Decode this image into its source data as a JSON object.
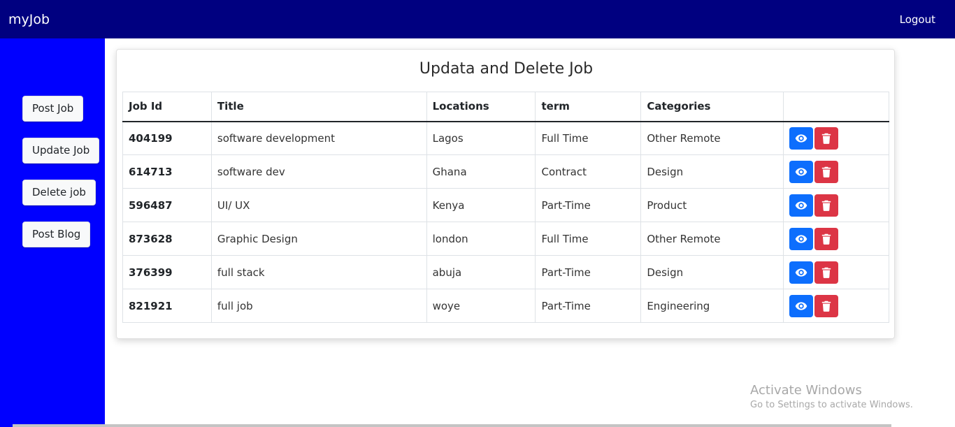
{
  "header": {
    "brand": "myJob",
    "logout_label": "Logout"
  },
  "sidebar": {
    "buttons": [
      {
        "label": "Post Job"
      },
      {
        "label": "Update Job"
      },
      {
        "label": "Delete job"
      },
      {
        "label": "Post Blog"
      }
    ]
  },
  "main": {
    "title": "Updata and Delete Job",
    "columns": [
      "Job Id",
      "Title",
      "Locations",
      "term",
      "Categories",
      ""
    ],
    "rows": [
      {
        "id": "404199",
        "title": "software development",
        "location": "Lagos",
        "term": "Full Time",
        "category": "Other Remote"
      },
      {
        "id": "614713",
        "title": "software dev",
        "location": "Ghana",
        "term": "Contract",
        "category": "Design"
      },
      {
        "id": "596487",
        "title": "UI/ UX",
        "location": "Kenya",
        "term": "Part-Time",
        "category": "Product"
      },
      {
        "id": "873628",
        "title": "Graphic Design",
        "location": "london",
        "term": "Full Time",
        "category": "Other Remote"
      },
      {
        "id": "376399",
        "title": "full stack",
        "location": "abuja",
        "term": "Part-Time",
        "category": "Design"
      },
      {
        "id": "821921",
        "title": "full job",
        "location": "woye",
        "term": "Part-Time",
        "category": "Engineering"
      }
    ],
    "row_actions": {
      "view_icon": "eye-icon",
      "delete_icon": "trash-icon"
    }
  },
  "watermark": {
    "line1": "Activate Windows",
    "line2": "Go to Settings to activate Windows."
  },
  "colors": {
    "navbar": "#000080",
    "sidebar": "#0000ff",
    "view_button": "#0d6efd",
    "delete_button": "#dc3545"
  }
}
